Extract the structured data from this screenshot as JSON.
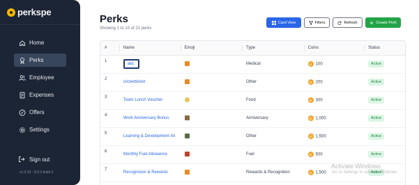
{
  "brand": {
    "name": "perkspe"
  },
  "sidebar": {
    "items": [
      {
        "label": "Home",
        "icon": "home-icon",
        "active": false
      },
      {
        "label": "Perks",
        "icon": "award-icon",
        "active": true
      },
      {
        "label": "Employee",
        "icon": "users-icon",
        "active": false
      },
      {
        "label": "Expenses",
        "icon": "receipt-icon",
        "active": false
      },
      {
        "label": "Offers",
        "icon": "discount-icon",
        "active": false
      },
      {
        "label": "Settings",
        "icon": "gear-icon",
        "active": false
      }
    ],
    "signout_label": "Sign out",
    "version": "v1.0.33 - 0.0.3-build.2"
  },
  "header": {
    "title": "Perks",
    "subtitle": "Showing 1 to 10 of 21 perks",
    "buttons": {
      "card_view": "Card View",
      "filters": "Filters",
      "refresh": "Refresh",
      "create": "Create Perk"
    }
  },
  "table": {
    "columns": [
      "#",
      "Name",
      "Emoji",
      "Type",
      "Coins",
      "Status"
    ],
    "rows": [
      {
        "num": "1",
        "name": "abc",
        "emoji": "gift",
        "type": "Medical",
        "coins": "100",
        "status": "Active"
      },
      {
        "num": "2",
        "name": "cricketticket",
        "emoji": "gift",
        "type": "Other",
        "coins": "200",
        "status": "Active"
      },
      {
        "num": "3",
        "name": "Team Lunch Voucher",
        "emoji": "food",
        "type": "Food",
        "coins": "300",
        "status": "Active"
      },
      {
        "num": "4",
        "name": "Work Anniversary Bonus",
        "emoji": "house",
        "type": "Anniversary",
        "coins": "1,000",
        "status": "Active"
      },
      {
        "num": "5",
        "name": "Learning & Development All",
        "emoji": "book",
        "type": "Other",
        "coins": "1,500",
        "status": "Active"
      },
      {
        "num": "6",
        "name": "Monthly Fuel Allowance",
        "emoji": "fuel",
        "type": "Fuel",
        "coins": "500",
        "status": "Active"
      },
      {
        "num": "7",
        "name": "Recognision & Rewards",
        "emoji": "gift",
        "type": "Rewards & Recognition",
        "coins": "1,500",
        "status": "Active"
      }
    ]
  },
  "watermark": {
    "line1": "Activate Windows",
    "line2": "Go to Settings to activate Windows."
  },
  "colors": {
    "sidebar_bg": "#1c2536",
    "accent_blue": "#2a67e8",
    "create_green": "#22a447",
    "active_badge_bg": "#dcf5e4",
    "coin": "#f4a531"
  }
}
